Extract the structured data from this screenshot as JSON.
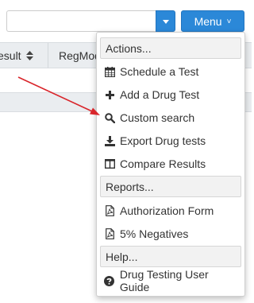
{
  "search": {
    "value": "",
    "placeholder": ""
  },
  "toolbar": {
    "menu_label": "Menu",
    "menu_chevron": "˅"
  },
  "table": {
    "columns": [
      {
        "label": "esult"
      },
      {
        "label": "RegMod"
      }
    ]
  },
  "menu": {
    "sections": {
      "actions": "Actions...",
      "reports": "Reports...",
      "help": "Help..."
    },
    "items": {
      "schedule_test": "Schedule a Test",
      "add_drug_test": "Add a Drug Test",
      "custom_search": "Custom search",
      "export_drug_tests": "Export Drug tests",
      "compare_results": "Compare Results",
      "authorization_form": "Authorization Form",
      "five_percent_negatives": "5% Negatives",
      "user_guide": "Drug Testing User Guide"
    },
    "icons": {
      "schedule_test": "calendar-icon",
      "add_drug_test": "plus-icon",
      "custom_search": "search-icon",
      "export_drug_tests": "download-icon",
      "compare_results": "columns-icon",
      "authorization_form": "pdf-file-icon",
      "five_percent_negatives": "pdf-file-icon",
      "user_guide": "question-circle-icon"
    }
  },
  "colors": {
    "accent": "#2b88d8",
    "arrow": "#d9252b",
    "header_bg": "#eaedf0",
    "section_bg": "#f2f2f2"
  }
}
